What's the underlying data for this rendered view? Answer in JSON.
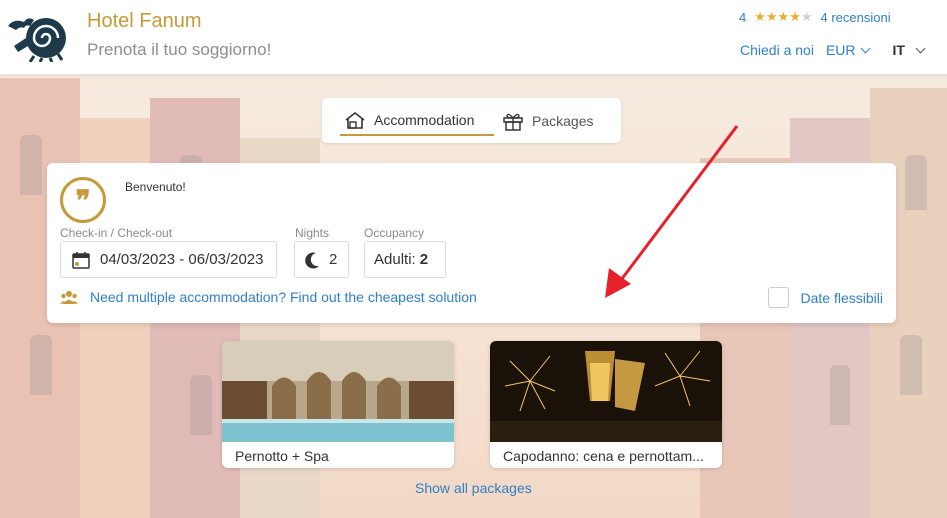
{
  "header": {
    "hotel_name": "Hotel Fanum",
    "tagline": "Prenota il tuo soggiorno!",
    "rating_value": "4",
    "rating_stars": 4,
    "rating_max": 5,
    "reviews": "4 recensioni",
    "contact_link": "Chiedi a noi",
    "currency": "EUR",
    "language": "IT"
  },
  "tabs": [
    {
      "label": "Accommodation",
      "icon": "house-icon",
      "active": true
    },
    {
      "label": "Packages",
      "icon": "gift-icon",
      "active": false
    }
  ],
  "booking": {
    "welcome": "Benvenuto!",
    "checkin_label": "Check-in / Check-out",
    "dates_value": "04/03/2023 - 06/03/2023",
    "nights_label": "Nights",
    "nights_value": "2",
    "occupancy_label": "Occupancy",
    "occupancy_prefix": "Adulti:",
    "occupancy_value": "2",
    "multi_link": "Need multiple accommodation? Find out the cheapest solution",
    "flexible_dates": "Date flessibili"
  },
  "packages": [
    {
      "title": "Pernotto + Spa"
    },
    {
      "title": "Capodanno: cena e pernottam..."
    }
  ],
  "show_all": "Show all packages",
  "colors": {
    "brand": "#c49a3a",
    "link": "#2f7fc9",
    "arrow": "#e5222a"
  }
}
